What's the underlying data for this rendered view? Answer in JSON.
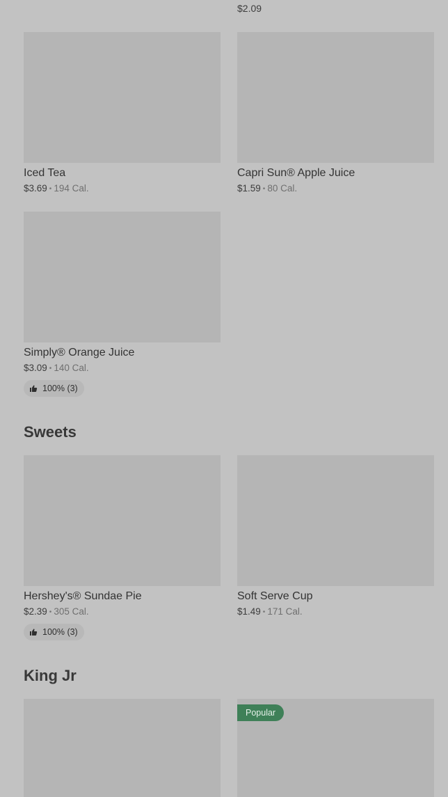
{
  "top_item": {
    "price": "$2.09"
  },
  "drinks": {
    "items": [
      {
        "name": "Iced Tea",
        "price": "$3.69",
        "calories": "194 Cal."
      },
      {
        "name": "Capri Sun® Apple Juice",
        "price": "$1.59",
        "calories": "80 Cal."
      },
      {
        "name": "Simply® Orange Juice",
        "price": "$3.09",
        "calories": "140 Cal.",
        "rating": "100% (3)"
      }
    ]
  },
  "sweets": {
    "title": "Sweets",
    "items": [
      {
        "name": "Hershey's® Sundae Pie",
        "price": "$2.39",
        "calories": "305 Cal.",
        "rating": "100% (3)"
      },
      {
        "name": "Soft Serve Cup",
        "price": "$1.49",
        "calories": "171 Cal."
      }
    ]
  },
  "king_jr": {
    "title": "King Jr",
    "items": [
      {},
      {
        "badge": "Popular"
      }
    ]
  },
  "icons": {
    "thumbs_up": "thumbs-up-icon"
  },
  "colors": {
    "background": "#c2c2c2",
    "placeholder": "#b5b5b5",
    "popular_badge": "#3f8058"
  }
}
